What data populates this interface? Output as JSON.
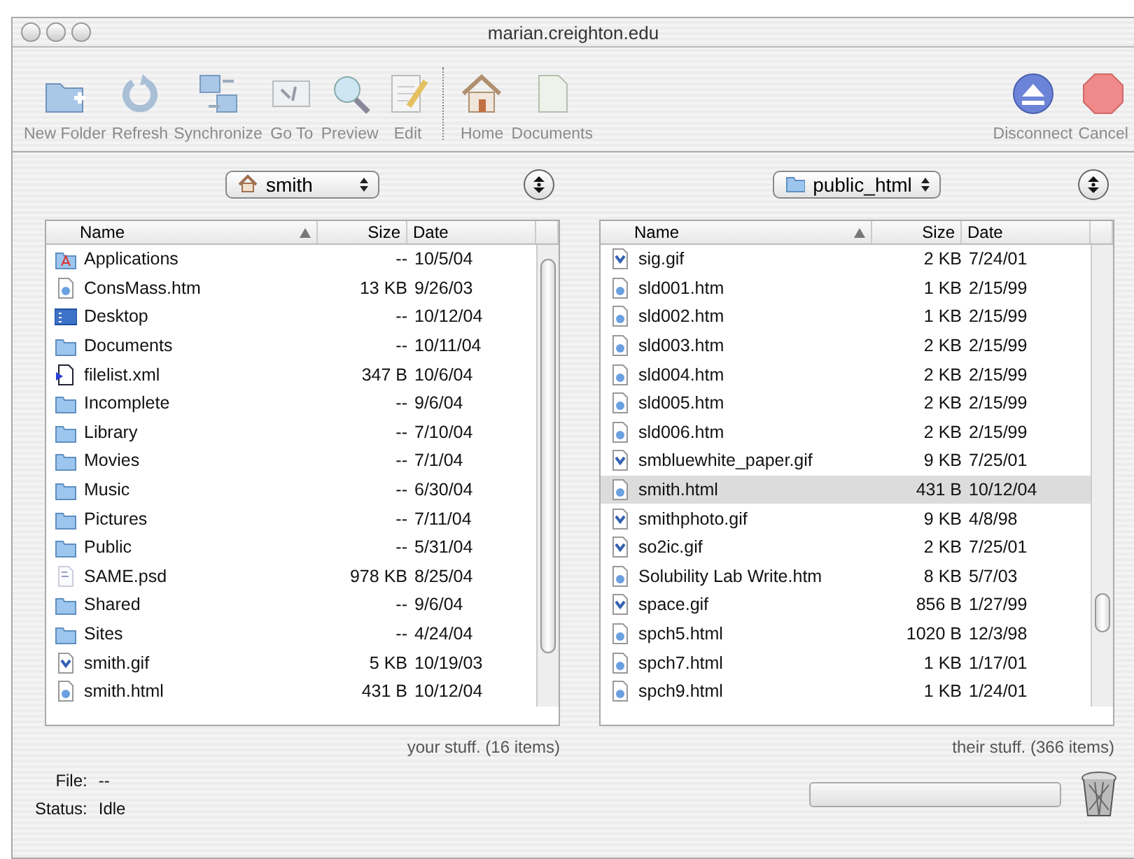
{
  "window": {
    "title": "marian.creighton.edu"
  },
  "toolbar": [
    {
      "label": "New Folder",
      "kind": "new-folder"
    },
    {
      "label": "Refresh",
      "kind": "refresh"
    },
    {
      "label": "Synchronize",
      "kind": "sync"
    },
    {
      "label": "Go To",
      "kind": "goto"
    },
    {
      "label": "Preview",
      "kind": "preview"
    },
    {
      "label": "Edit",
      "kind": "edit"
    },
    {
      "label": "Home",
      "kind": "home"
    },
    {
      "label": "Documents",
      "kind": "documents"
    },
    {
      "label": "Disconnect",
      "kind": "disconnect"
    },
    {
      "label": "Cancel",
      "kind": "cancel"
    }
  ],
  "panes": [
    {
      "location": "smith",
      "kind": "home",
      "columns": [
        "Name",
        "Size",
        "Date"
      ],
      "summary": "your stuff. (16 items)",
      "rows": [
        {
          "name": "Applications",
          "size": "--",
          "date": "10/5/04",
          "kind": "app",
          "selected": false
        },
        {
          "name": "ConsMass.htm",
          "size": "13 KB",
          "date": "9/26/03",
          "kind": "html",
          "selected": false
        },
        {
          "name": "Desktop",
          "size": "--",
          "date": "10/12/04",
          "kind": "desktop",
          "selected": false
        },
        {
          "name": "Documents",
          "size": "--",
          "date": "10/11/04",
          "kind": "folder",
          "selected": false
        },
        {
          "name": "filelist.xml",
          "size": "347 B",
          "date": "10/6/04",
          "kind": "xml",
          "selected": false
        },
        {
          "name": "Incomplete",
          "size": "--",
          "date": "9/6/04",
          "kind": "folder",
          "selected": false
        },
        {
          "name": "Library",
          "size": "--",
          "date": "7/10/04",
          "kind": "folder",
          "selected": false
        },
        {
          "name": "Movies",
          "size": "--",
          "date": "7/1/04",
          "kind": "folder",
          "selected": false
        },
        {
          "name": "Music",
          "size": "--",
          "date": "6/30/04",
          "kind": "folder",
          "selected": false
        },
        {
          "name": "Pictures",
          "size": "--",
          "date": "7/11/04",
          "kind": "folder",
          "selected": false
        },
        {
          "name": "Public",
          "size": "--",
          "date": "5/31/04",
          "kind": "folder",
          "selected": false
        },
        {
          "name": "SAME.psd",
          "size": "978 KB",
          "date": "8/25/04",
          "kind": "doc",
          "selected": false
        },
        {
          "name": "Shared",
          "size": "--",
          "date": "9/6/04",
          "kind": "folder",
          "selected": false
        },
        {
          "name": "Sites",
          "size": "--",
          "date": "4/24/04",
          "kind": "folder",
          "selected": false
        },
        {
          "name": "smith.gif",
          "size": "5 KB",
          "date": "10/19/03",
          "kind": "image",
          "selected": false
        },
        {
          "name": "smith.html",
          "size": "431 B",
          "date": "10/12/04",
          "kind": "html",
          "selected": false
        }
      ]
    },
    {
      "location": "public_html",
      "kind": "folder",
      "columns": [
        "Name",
        "Size",
        "Date"
      ],
      "summary": "their stuff. (366 items)",
      "rows": [
        {
          "name": "sig.gif",
          "size": "2 KB",
          "date": "7/24/01",
          "kind": "image",
          "selected": false
        },
        {
          "name": "sld001.htm",
          "size": "1 KB",
          "date": "2/15/99",
          "kind": "html",
          "selected": false
        },
        {
          "name": "sld002.htm",
          "size": "1 KB",
          "date": "2/15/99",
          "kind": "html",
          "selected": false
        },
        {
          "name": "sld003.htm",
          "size": "2 KB",
          "date": "2/15/99",
          "kind": "html",
          "selected": false
        },
        {
          "name": "sld004.htm",
          "size": "2 KB",
          "date": "2/15/99",
          "kind": "html",
          "selected": false
        },
        {
          "name": "sld005.htm",
          "size": "2 KB",
          "date": "2/15/99",
          "kind": "html",
          "selected": false
        },
        {
          "name": "sld006.htm",
          "size": "2 KB",
          "date": "2/15/99",
          "kind": "html",
          "selected": false
        },
        {
          "name": "smbluewhite_paper.gif",
          "size": "9 KB",
          "date": "7/25/01",
          "kind": "image",
          "selected": false
        },
        {
          "name": "smith.html",
          "size": "431 B",
          "date": "10/12/04",
          "kind": "html",
          "selected": true
        },
        {
          "name": "smithphoto.gif",
          "size": "9 KB",
          "date": "4/8/98",
          "kind": "image",
          "selected": false
        },
        {
          "name": "so2ic.gif",
          "size": "2 KB",
          "date": "7/25/01",
          "kind": "image",
          "selected": false
        },
        {
          "name": "Solubility Lab Write.htm",
          "size": "8 KB",
          "date": "5/7/03",
          "kind": "html",
          "selected": false
        },
        {
          "name": "space.gif",
          "size": "856 B",
          "date": "1/27/99",
          "kind": "image",
          "selected": false
        },
        {
          "name": "spch5.html",
          "size": "1020 B",
          "date": "12/3/98",
          "kind": "html",
          "selected": false
        },
        {
          "name": "spch7.html",
          "size": "1 KB",
          "date": "1/17/01",
          "kind": "html",
          "selected": false
        },
        {
          "name": "spch9.html",
          "size": "1 KB",
          "date": "1/24/01",
          "kind": "html",
          "selected": false
        }
      ]
    }
  ],
  "status": {
    "file_label": "File:",
    "file_value": "--",
    "status_label": "Status:",
    "status_value": "Idle"
  },
  "progress": {
    "level": 0
  }
}
